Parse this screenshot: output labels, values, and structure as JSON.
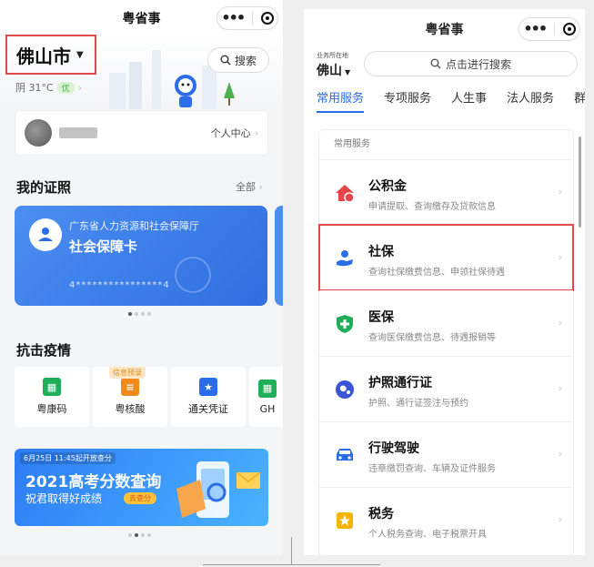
{
  "left": {
    "app_title": "粤省事",
    "city": "佛山市",
    "weather": "阴 31°C",
    "aqi": "优",
    "search_label": "搜索",
    "user_center": "个人中心",
    "licenses_title": "我的证照",
    "licenses_more": "全部",
    "license_card": {
      "org": "广东省人力资源和社会保障厅",
      "name": "社会保障卡",
      "number": "4****************4"
    },
    "epidemic_title": "抗击疫情",
    "tiles": [
      {
        "label": "粤康码",
        "color": "#1fae5a",
        "icon": "qr-code-icon",
        "tag": ""
      },
      {
        "label": "粤核酸",
        "color": "#f08a1d",
        "icon": "test-tube-icon",
        "tag": "信息预录"
      },
      {
        "label": "通关凭证",
        "color": "#2b6ce8",
        "icon": "pass-icon",
        "tag": ""
      },
      {
        "label": "GH",
        "color": "#1fae5a",
        "icon": "qr-code-icon",
        "tag": ""
      }
    ],
    "banner": {
      "time": "6月25日 11:45起开放查分",
      "title": "2021高考分数查询",
      "subtitle": "祝君取得好成绩",
      "button": "去查分"
    }
  },
  "right": {
    "app_title": "粤省事",
    "location_caption": "业务所在地",
    "city": "佛山",
    "search_placeholder": "点击进行搜索",
    "tabs": [
      {
        "label": "常用服务",
        "active": true
      },
      {
        "label": "专项服务",
        "active": false
      },
      {
        "label": "人生事",
        "active": false
      },
      {
        "label": "法人服务",
        "active": false
      },
      {
        "label": "群",
        "active": false
      }
    ],
    "list_header": "常用服务",
    "services": [
      {
        "title": "公积金",
        "desc": "申请提取、查询缴存及贷款信息",
        "color": "#e8454a",
        "icon": "house-icon"
      },
      {
        "title": "社保",
        "desc": "查询社保缴费信息、申领社保待遇",
        "color": "#2b6ce8",
        "icon": "person-hand-icon"
      },
      {
        "title": "医保",
        "desc": "查询医保缴费信息、待遇报销等",
        "color": "#1fae5a",
        "icon": "medical-shield-icon"
      },
      {
        "title": "护照通行证",
        "desc": "护照、通行证签注与预约",
        "color": "#3a56d8",
        "icon": "globe-icon"
      },
      {
        "title": "行驶驾驶",
        "desc": "违章缴罚查询、车辆及证件服务",
        "color": "#2b6ce8",
        "icon": "car-icon"
      },
      {
        "title": "税务",
        "desc": "个人税务查询、电子税票开具",
        "color": "#f4b400",
        "icon": "tax-icon"
      }
    ]
  }
}
